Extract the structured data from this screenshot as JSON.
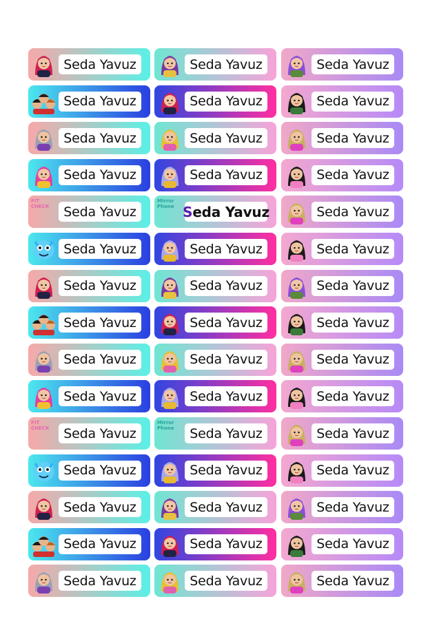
{
  "label_text": "Seda Yavuz",
  "columns": 3,
  "rows": 15,
  "gradients": {
    "peach_cyan": [
      "#f7a8a8",
      "#5af0e6"
    ],
    "cyan_blue": [
      "#4ce7ee",
      "#2b3fe0"
    ],
    "teal_pink": [
      "#6ee6d2",
      "#f7a3d9"
    ],
    "blue_magenta": [
      "#3046e0",
      "#ff2fa0"
    ],
    "pink_lavender": [
      "#f3a8cf",
      "#b68af7"
    ],
    "lavender": [
      "#f0a8c8",
      "#a98af5"
    ]
  },
  "promo_texts": {
    "col1": {
      "title": "FIT CHECK",
      "sub": "Napalm Era"
    },
    "col2": {
      "title": "Mirror Phone",
      "sub": "Mirror Phone"
    }
  },
  "labels": [
    [
      "girl-red-hair",
      "peach_cyan"
    ],
    [
      "bun-girl",
      "teal_pink"
    ],
    [
      "purple-hair-girl",
      "lavender"
    ],
    [
      "group-trio",
      "cyan_blue"
    ],
    [
      "girl-red-hair",
      "blue_magenta"
    ],
    [
      "dark-hair-boy",
      "pink_lavender"
    ],
    [
      "gray-hair-boy",
      "peach_cyan"
    ],
    [
      "yellow-hat-girl",
      "teal_pink"
    ],
    [
      "blonde-boy",
      "lavender"
    ],
    [
      "pink-hair-girl",
      "cyan_blue"
    ],
    [
      "gray-hair-girl",
      "blue_magenta"
    ],
    [
      "dark-hair-boy-2",
      "pink_lavender"
    ],
    [
      "promo-fitcheck",
      "peach_cyan"
    ],
    [
      "promo-mirror",
      "teal_pink"
    ],
    [
      "blonde-boy",
      "lavender"
    ],
    [
      "blue-creature",
      "cyan_blue"
    ],
    [
      "gray-hair-girl",
      "blue_magenta"
    ],
    [
      "dark-hair-boy-2",
      "pink_lavender"
    ],
    [
      "girl-red-hair",
      "peach_cyan"
    ],
    [
      "bun-girl",
      "teal_pink"
    ],
    [
      "purple-hair-girl",
      "lavender"
    ],
    [
      "group-trio",
      "cyan_blue"
    ],
    [
      "girl-red-hair",
      "blue_magenta"
    ],
    [
      "dark-hair-boy",
      "pink_lavender"
    ],
    [
      "gray-hair-boy",
      "peach_cyan"
    ],
    [
      "yellow-hat-girl",
      "teal_pink"
    ],
    [
      "blonde-boy",
      "lavender"
    ],
    [
      "pink-hair-girl",
      "cyan_blue"
    ],
    [
      "gray-hair-girl",
      "blue_magenta"
    ],
    [
      "dark-hair-boy-2",
      "pink_lavender"
    ],
    [
      "promo-fitcheck",
      "peach_cyan"
    ],
    [
      "promo-mirror",
      "teal_pink"
    ],
    [
      "blonde-boy",
      "lavender"
    ],
    [
      "blue-creature",
      "cyan_blue"
    ],
    [
      "gray-hair-girl",
      "blue_magenta"
    ],
    [
      "dark-hair-boy-2",
      "pink_lavender"
    ],
    [
      "girl-red-hair",
      "peach_cyan"
    ],
    [
      "bun-girl",
      "teal_pink"
    ],
    [
      "purple-hair-girl",
      "lavender"
    ],
    [
      "group-trio",
      "cyan_blue"
    ],
    [
      "girl-red-hair",
      "blue_magenta"
    ],
    [
      "dark-hair-boy",
      "pink_lavender"
    ],
    [
      "gray-hair-boy",
      "peach_cyan"
    ],
    [
      "yellow-hat-girl",
      "teal_pink"
    ],
    [
      "blonde-boy",
      "lavender"
    ]
  ]
}
